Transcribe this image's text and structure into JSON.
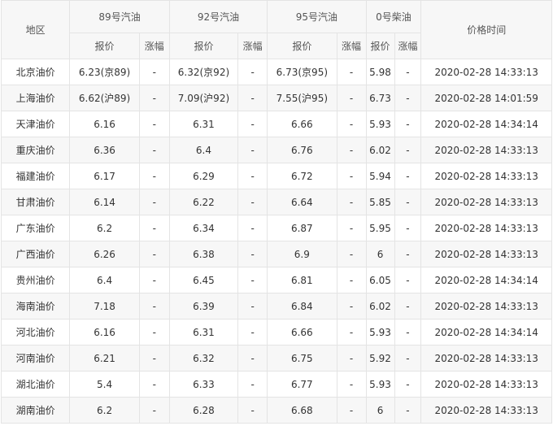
{
  "header": {
    "region": "地区",
    "fuels": [
      "89号汽油",
      "92号汽油",
      "95号汽油",
      "0号柴油"
    ],
    "price": "报价",
    "change": "涨幅",
    "time": "价格时间"
  },
  "rows": [
    {
      "region": "北京油价",
      "p89": "6.23(京89)",
      "c89": "-",
      "p92": "6.32(京92)",
      "c92": "-",
      "p95": "6.73(京95)",
      "c95": "-",
      "p0": "5.98",
      "c0": "-",
      "time": "2020-02-28 14:33:13"
    },
    {
      "region": "上海油价",
      "p89": "6.62(沪89)",
      "c89": "-",
      "p92": "7.09(沪92)",
      "c92": "-",
      "p95": "7.55(沪95)",
      "c95": "-",
      "p0": "6.73",
      "c0": "-",
      "time": "2020-02-28 14:01:59"
    },
    {
      "region": "天津油价",
      "p89": "6.16",
      "c89": "-",
      "p92": "6.31",
      "c92": "-",
      "p95": "6.66",
      "c95": "-",
      "p0": "5.93",
      "c0": "-",
      "time": "2020-02-28 14:34:14"
    },
    {
      "region": "重庆油价",
      "p89": "6.36",
      "c89": "-",
      "p92": "6.4",
      "c92": "-",
      "p95": "6.76",
      "c95": "-",
      "p0": "6.02",
      "c0": "-",
      "time": "2020-02-28 14:33:13"
    },
    {
      "region": "福建油价",
      "p89": "6.17",
      "c89": "-",
      "p92": "6.29",
      "c92": "-",
      "p95": "6.72",
      "c95": "-",
      "p0": "5.94",
      "c0": "-",
      "time": "2020-02-28 14:33:13"
    },
    {
      "region": "甘肃油价",
      "p89": "6.14",
      "c89": "-",
      "p92": "6.22",
      "c92": "-",
      "p95": "6.64",
      "c95": "-",
      "p0": "5.85",
      "c0": "-",
      "time": "2020-02-28 14:33:13"
    },
    {
      "region": "广东油价",
      "p89": "6.2",
      "c89": "-",
      "p92": "6.34",
      "c92": "-",
      "p95": "6.87",
      "c95": "-",
      "p0": "5.95",
      "c0": "-",
      "time": "2020-02-28 14:33:13"
    },
    {
      "region": "广西油价",
      "p89": "6.26",
      "c89": "-",
      "p92": "6.38",
      "c92": "-",
      "p95": "6.9",
      "c95": "-",
      "p0": "6",
      "c0": "-",
      "time": "2020-02-28 14:33:13"
    },
    {
      "region": "贵州油价",
      "p89": "6.4",
      "c89": "-",
      "p92": "6.45",
      "c92": "-",
      "p95": "6.81",
      "c95": "-",
      "p0": "6.05",
      "c0": "-",
      "time": "2020-02-28 14:34:14"
    },
    {
      "region": "海南油价",
      "p89": "7.18",
      "c89": "-",
      "p92": "6.39",
      "c92": "-",
      "p95": "6.84",
      "c95": "-",
      "p0": "6.02",
      "c0": "-",
      "time": "2020-02-28 14:33:13"
    },
    {
      "region": "河北油价",
      "p89": "6.16",
      "c89": "-",
      "p92": "6.31",
      "c92": "-",
      "p95": "6.66",
      "c95": "-",
      "p0": "5.93",
      "c0": "-",
      "time": "2020-02-28 14:34:14"
    },
    {
      "region": "河南油价",
      "p89": "6.21",
      "c89": "-",
      "p92": "6.32",
      "c92": "-",
      "p95": "6.75",
      "c95": "-",
      "p0": "5.92",
      "c0": "-",
      "time": "2020-02-28 14:33:13"
    },
    {
      "region": "湖北油价",
      "p89": "5.4",
      "c89": "-",
      "p92": "6.33",
      "c92": "-",
      "p95": "6.77",
      "c95": "-",
      "p0": "5.93",
      "c0": "-",
      "time": "2020-02-28 14:33:13"
    },
    {
      "region": "湖南油价",
      "p89": "6.2",
      "c89": "-",
      "p92": "6.28",
      "c92": "-",
      "p95": "6.68",
      "c95": "-",
      "p0": "6",
      "c0": "-",
      "time": "2020-02-28 14:33:13"
    }
  ]
}
